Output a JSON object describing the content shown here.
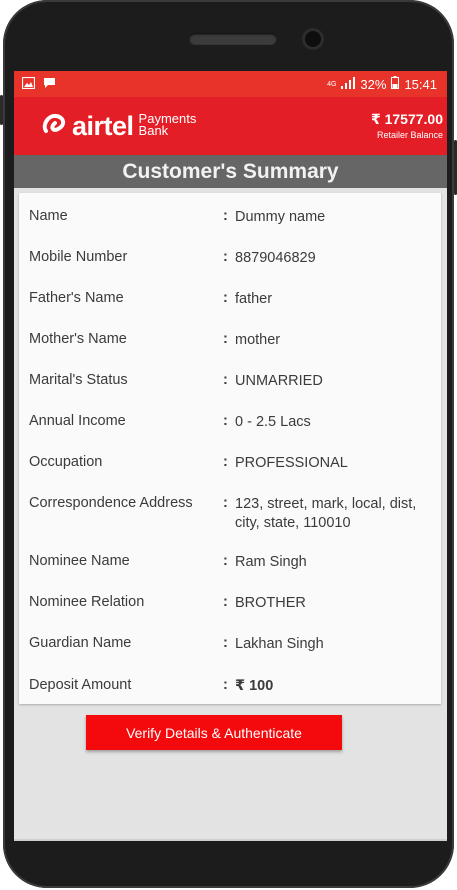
{
  "status_bar": {
    "network": "4G",
    "battery": "32%",
    "time": "15:41"
  },
  "app_bar": {
    "brand": "airtel",
    "brand_sub_1": "Payments",
    "brand_sub_2": "Bank",
    "balance": "₹ 17577.00",
    "balance_label": "Retailer Balance"
  },
  "page": {
    "title": "Customer's Summary"
  },
  "summary": {
    "separator": ":",
    "rows": [
      {
        "label": "Name",
        "value": "Dummy name"
      },
      {
        "label": "Mobile Number",
        "value": "8879046829"
      },
      {
        "label": "Father's Name",
        "value": "father"
      },
      {
        "label": "Mother's Name",
        "value": "mother"
      },
      {
        "label": "Marital's Status",
        "value": "UNMARRIED"
      },
      {
        "label": "Annual Income",
        "value": "0 - 2.5 Lacs"
      },
      {
        "label": "Occupation",
        "value": "PROFESSIONAL"
      },
      {
        "label": "Correspondence Address",
        "value": "123, street, mark, local, dist, city, state, 110010"
      },
      {
        "label": "Nominee Name",
        "value": "Ram Singh"
      },
      {
        "label": "Nominee Relation",
        "value": "BROTHER"
      },
      {
        "label": "Guardian Name",
        "value": "Lakhan Singh"
      },
      {
        "label": "Deposit Amount",
        "value": "₹ 100"
      }
    ]
  },
  "actions": {
    "verify_label": "Verify Details & Authenticate"
  },
  "colors": {
    "brand_red": "#e41e26",
    "status_red": "#e8332b",
    "button_red": "#f4090c",
    "title_gray": "#666666"
  }
}
